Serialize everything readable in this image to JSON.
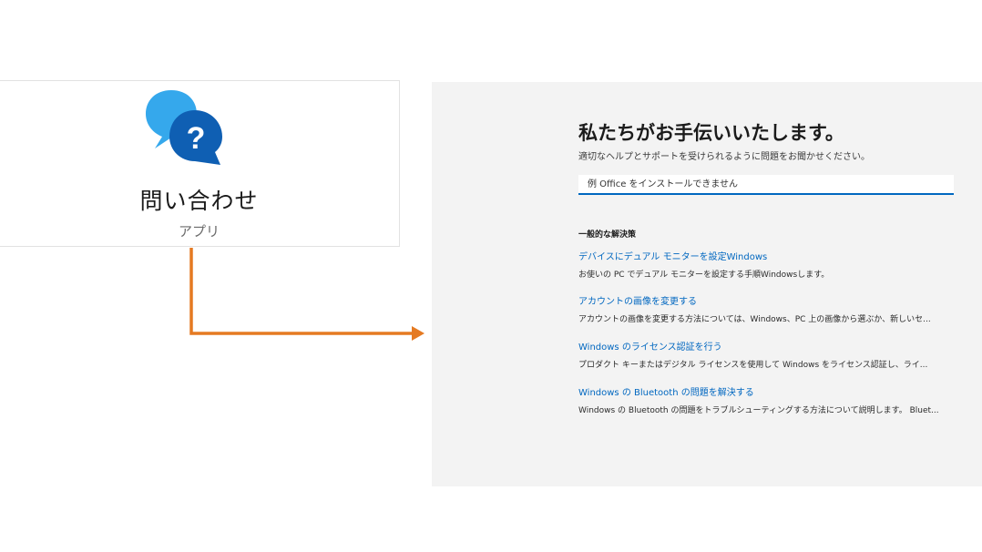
{
  "app_tile": {
    "name": "問い合わせ",
    "type": "アプリ",
    "icon": "get-help-icon",
    "colors": {
      "bubble_back": "#35a8ec",
      "bubble_front": "#0f5fb3",
      "question_mark": "#ffffff"
    }
  },
  "connector": {
    "color": "#e57a22",
    "icon": "arrow-right"
  },
  "help": {
    "title": "私たちがお手伝いいたします。",
    "subtitle": "適切なヘルプとサポートを受けられるように問題をお聞かせください。",
    "search": {
      "placeholder": "例 Office をインストールできません"
    },
    "section_heading": "一般的な解決策",
    "solutions": [
      {
        "title": "デバイスにデュアル モニターを設定Windows",
        "description": "お使いの PC でデュアル モニターを設定する手順Windowsします。"
      },
      {
        "title": "アカウントの画像を変更する",
        "description": "アカウントの画像を変更する方法については、Windows、PC 上の画像から選ぶか、新しいセ..."
      },
      {
        "title": "Windows のライセンス認証を行う",
        "description": "プロダクト キーまたはデジタル ライセンスを使用して Windows をライセンス認証し、ライ..."
      },
      {
        "title": "Windows の Bluetooth の問題を解決する",
        "description": "Windows の Bluetooth の問題をトラブルシューティングする方法について説明します。 Bluet..."
      }
    ],
    "colors": {
      "link": "#0067c0",
      "background": "#f3f3f3",
      "search_underline": "#0067c0"
    }
  }
}
